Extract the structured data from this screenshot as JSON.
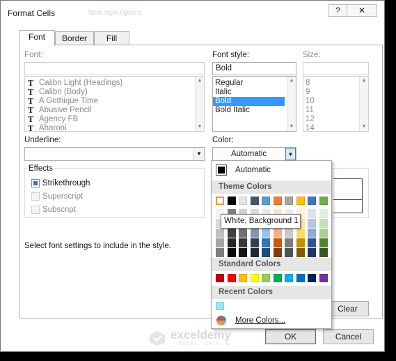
{
  "window": {
    "title": "Format Cells",
    "ghost_title": "Table Style Options"
  },
  "tabs": [
    "Font",
    "Border",
    "Fill"
  ],
  "font": {
    "label": "Font:",
    "value": "",
    "items": [
      "Calibri Light (Headings)",
      "Calibri (Body)",
      "A Gothique Time",
      "Abusive Pencil",
      "Agency FB",
      "Aharoni"
    ]
  },
  "font_style": {
    "label": "Font style:",
    "value": "Bold",
    "items": [
      "Regular",
      "Italic",
      "Bold",
      "Bold Italic"
    ],
    "selected": "Bold"
  },
  "size": {
    "label": "Size:",
    "value": "",
    "items": [
      "8",
      "9",
      "10",
      "11",
      "12",
      "14"
    ]
  },
  "underline": {
    "label": "Underline:",
    "value": ""
  },
  "color": {
    "label": "Color:",
    "value": "Automatic"
  },
  "effects": {
    "label": "Effects",
    "items": [
      {
        "label": "Strikethrough",
        "checked": true,
        "enabled": true
      },
      {
        "label": "Superscript",
        "checked": false,
        "enabled": false
      },
      {
        "label": "Subscript",
        "checked": false,
        "enabled": false
      }
    ]
  },
  "hint": "Select font settings to include in the style.",
  "color_picker": {
    "automatic_label": "Automatic",
    "theme_header": "Theme Colors",
    "theme_top_row": [
      "#ffffff",
      "#000000",
      "#e7e6e6",
      "#44546a",
      "#5b9bd5",
      "#ed7d31",
      "#a5a5a5",
      "#ffc000",
      "#4472c4",
      "#70ad47"
    ],
    "theme_shades": [
      [
        "#f2f2f2",
        "#7f7f7f",
        "#d0cece",
        "#d6dce4",
        "#deebf6",
        "#fbe5d5",
        "#ededed",
        "#fff2cc",
        "#d9e2f3",
        "#e2efd9"
      ],
      [
        "#d8d8d8",
        "#595959",
        "#aeabab",
        "#adb9ca",
        "#bdd7ee",
        "#f7cbac",
        "#dbdbdb",
        "#fee599",
        "#b4c6e7",
        "#c5e0b3"
      ],
      [
        "#bfbfbf",
        "#3f3f3f",
        "#757070",
        "#8496b0",
        "#9cc3e5",
        "#f4b183",
        "#c9c9c9",
        "#ffd965",
        "#8eaadb",
        "#a8d08d"
      ],
      [
        "#a5a5a5",
        "#262626",
        "#3a3838",
        "#323f4f",
        "#2e75b5",
        "#c55a11",
        "#7b7b7b",
        "#bf9000",
        "#2f5496",
        "#538135"
      ],
      [
        "#7f7f7f",
        "#0c0c0c",
        "#171616",
        "#222a35",
        "#1e4e79",
        "#833c0b",
        "#525252",
        "#7f6000",
        "#1f3864",
        "#375623"
      ]
    ],
    "standard_header": "Standard Colors",
    "standard_colors": [
      "#c00000",
      "#ff0000",
      "#ffc000",
      "#ffff00",
      "#92d050",
      "#00b050",
      "#00b0f0",
      "#0070c0",
      "#002060",
      "#7030a0"
    ],
    "recent_header": "Recent Colors",
    "recent_colors": [
      "#99e6ff"
    ],
    "more_label": "More Colors...",
    "tooltip": "White, Background 1"
  },
  "buttons": {
    "clear": "Clear",
    "ok": "OK",
    "cancel": "Cancel"
  },
  "watermark": {
    "name": "exceldemy",
    "tagline": "EXCEL · DATA · BI"
  }
}
